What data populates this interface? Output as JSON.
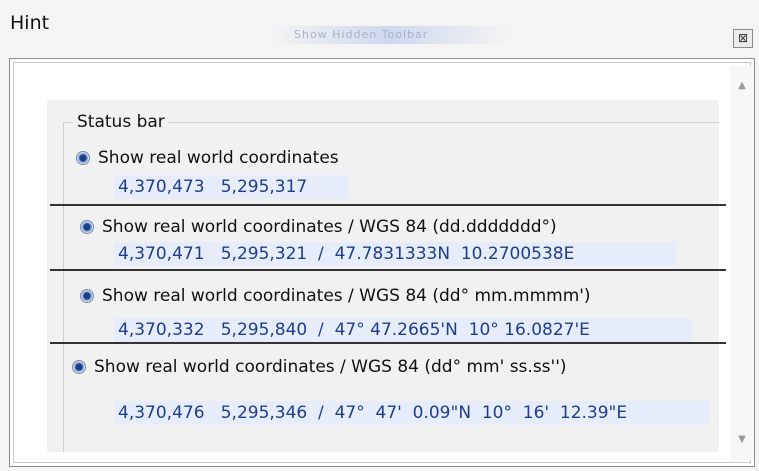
{
  "window": {
    "title": "Hint",
    "ghost_text": "Show Hidden Toolbar",
    "close_glyph": "⊠"
  },
  "panel": {
    "group_label": "Status bar",
    "options": [
      {
        "label": "Show real world coordinates",
        "coords": "4,370,473   5,295,317  ",
        "selected": true
      },
      {
        "label": "Show real world coordinates / WGS 84 (dd.ddddddd°)",
        "coords": "4,370,471   5,295,321  /  47.7831333N  10.2700538E",
        "selected": true
      },
      {
        "label": "Show real world coordinates / WGS 84 (dd° mm.mmmm')",
        "coords": "4,370,332   5,295,840  /  47° 47.2665'N  10° 16.0827'E",
        "selected": true
      },
      {
        "label": "Show real world coordinates / WGS 84 (dd° mm' ss.ss'')",
        "coords": "4,370,476   5,295,346  /  47°  47'  0.09\"N  10°  16'  12.39\"E",
        "selected": true
      }
    ]
  },
  "scrollbar": {
    "up_glyph": "▲",
    "down_glyph": "▼"
  },
  "colors": {
    "coord_text": "#1d3f8c",
    "coord_bg": "#e6ecf9",
    "radio_fill": "#1c3f86"
  }
}
